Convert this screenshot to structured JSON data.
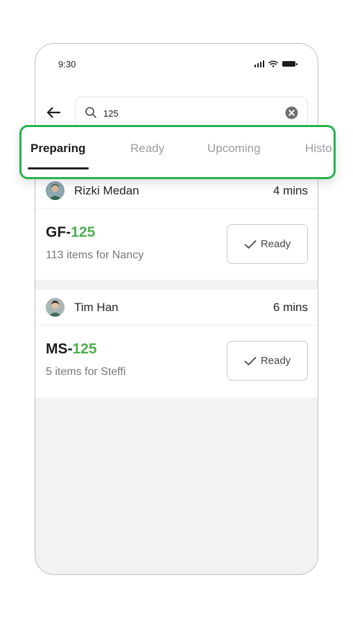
{
  "status_bar": {
    "time": "9:30",
    "icons": [
      "signal-icon",
      "wifi-icon",
      "battery-icon"
    ]
  },
  "search": {
    "value": "125",
    "icon": "search-icon",
    "clear_icon": "clear-icon"
  },
  "back_icon": "arrow-left-icon",
  "tabs": [
    {
      "label": "Preparing",
      "active": true
    },
    {
      "label": "Ready",
      "active": false
    },
    {
      "label": "Upcoming",
      "active": false
    },
    {
      "label": "Histo",
      "active": false
    }
  ],
  "orders": [
    {
      "driver": "Rizki Medan",
      "eta": "4 mins",
      "code_prefix": "GF-",
      "code_suffix": "125",
      "items": "113 items for Nancy",
      "action_label": "Ready"
    },
    {
      "driver": "Tim Han",
      "eta": "6 mins",
      "code_prefix": "MS-",
      "code_suffix": "125",
      "items": "5 items for Steffi",
      "action_label": "Ready"
    }
  ],
  "colors": {
    "accent_green": "#4caf50",
    "highlight_border": "#22b34c",
    "background": "#f2f2f2"
  }
}
